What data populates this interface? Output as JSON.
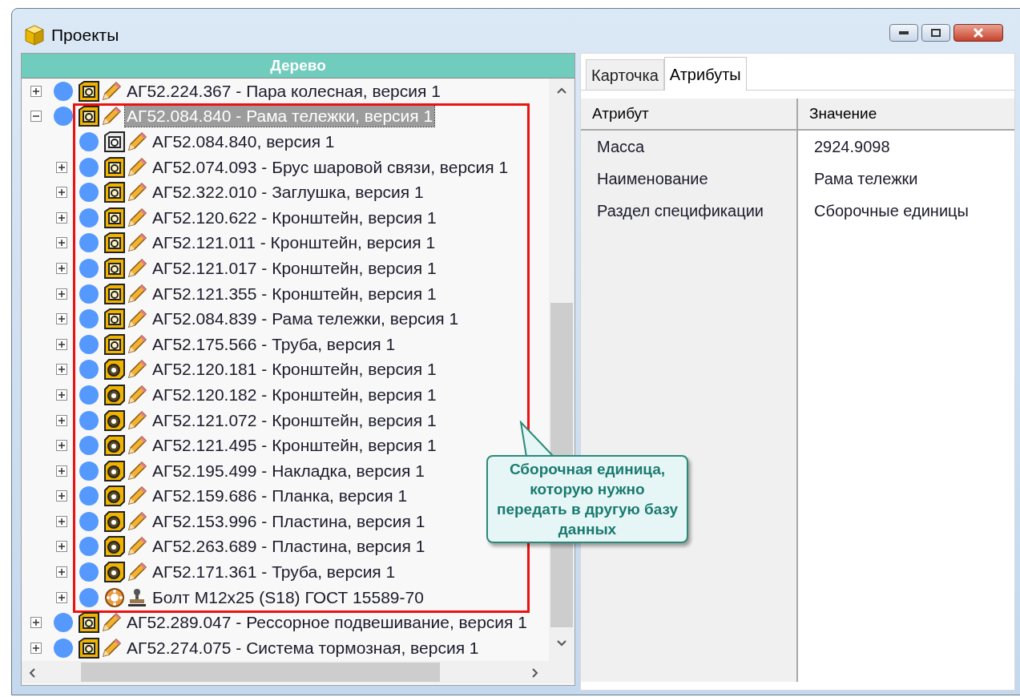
{
  "window": {
    "title": "Проекты"
  },
  "tree": {
    "header": "Дерево",
    "nodes": [
      {
        "label": "АГ52.224.367 - Пара колесная, версия 1",
        "kind": "assembly",
        "has_children": true,
        "expanded": false,
        "selected": false
      },
      {
        "label": "АГ52.084.840 - Рама тележки, версия 1",
        "kind": "assembly",
        "has_children": true,
        "expanded": true,
        "selected": true,
        "framed": true,
        "children": [
          {
            "label": "АГ52.084.840, версия 1",
            "kind": "document",
            "has_children": false,
            "selected": false
          },
          {
            "label": "АГ52.074.093 - Брус шаровой связи, версия 1",
            "kind": "assembly",
            "has_children": true,
            "expanded": false,
            "selected": false
          },
          {
            "label": "АГ52.322.010 - Заглушка, версия 1",
            "kind": "assembly",
            "has_children": true,
            "expanded": false,
            "selected": false
          },
          {
            "label": "АГ52.120.622 - Кронштейн, версия 1",
            "kind": "assembly",
            "has_children": true,
            "expanded": false,
            "selected": false
          },
          {
            "label": "АГ52.121.011 - Кронштейн, версия 1",
            "kind": "assembly",
            "has_children": true,
            "expanded": false,
            "selected": false
          },
          {
            "label": "АГ52.121.017 - Кронштейн, версия 1",
            "kind": "assembly",
            "has_children": true,
            "expanded": false,
            "selected": false
          },
          {
            "label": "АГ52.121.355 - Кронштейн, версия 1",
            "kind": "assembly",
            "has_children": true,
            "expanded": false,
            "selected": false
          },
          {
            "label": "АГ52.084.839 - Рама тележки, версия 1",
            "kind": "assembly",
            "has_children": true,
            "expanded": false,
            "selected": false
          },
          {
            "label": "АГ52.175.566 - Труба, версия 1",
            "kind": "assembly",
            "has_children": true,
            "expanded": false,
            "selected": false
          },
          {
            "label": "АГ52.120.181 - Кронштейн, версия 1",
            "kind": "part",
            "has_children": true,
            "expanded": false,
            "selected": false
          },
          {
            "label": "АГ52.120.182 - Кронштейн, версия 1",
            "kind": "part",
            "has_children": true,
            "expanded": false,
            "selected": false
          },
          {
            "label": "АГ52.121.072 - Кронштейн, версия 1",
            "kind": "part",
            "has_children": true,
            "expanded": false,
            "selected": false
          },
          {
            "label": "АГ52.121.495 - Кронштейн, версия 1",
            "kind": "part",
            "has_children": true,
            "expanded": false,
            "selected": false
          },
          {
            "label": "АГ52.195.499 - Накладка, версия 1",
            "kind": "part",
            "has_children": true,
            "expanded": false,
            "selected": false
          },
          {
            "label": "АГ52.159.686 - Планка, версия 1",
            "kind": "part",
            "has_children": true,
            "expanded": false,
            "selected": false
          },
          {
            "label": "АГ52.153.996 - Пластина, версия 1",
            "kind": "part",
            "has_children": true,
            "expanded": false,
            "selected": false
          },
          {
            "label": "АГ52.263.689 - Пластина, версия 1",
            "kind": "part",
            "has_children": true,
            "expanded": false,
            "selected": false
          },
          {
            "label": "АГ52.171.361 - Труба, версия 1",
            "kind": "part",
            "has_children": true,
            "expanded": false,
            "selected": false
          },
          {
            "label": "Болт М12x25 (S18) ГОСТ 15589-70",
            "kind": "standard",
            "has_children": true,
            "expanded": false,
            "selected": false
          }
        ]
      },
      {
        "label": "АГ52.289.047 - Рессорное подвешивание, версия 1",
        "kind": "assembly",
        "has_children": true,
        "expanded": false,
        "selected": false
      },
      {
        "label": "АГ52.274.075 - Система тормозная, версия 1",
        "kind": "assembly",
        "has_children": true,
        "expanded": false,
        "selected": false
      }
    ],
    "callout": "Сборочная единица, которую нужно передать в другую базу данных"
  },
  "tabs": [
    {
      "label": "Карточка",
      "selected": false
    },
    {
      "label": "Атрибуты",
      "selected": true
    }
  ],
  "attributes": {
    "columns": [
      "Атрибут",
      "Значение"
    ],
    "rows": [
      {
        "name": "Масса",
        "value": "2924.9098"
      },
      {
        "name": "Наименование",
        "value": "Рама тележки"
      },
      {
        "name": "Раздел спецификации",
        "value": "Сборочные единицы"
      }
    ]
  }
}
